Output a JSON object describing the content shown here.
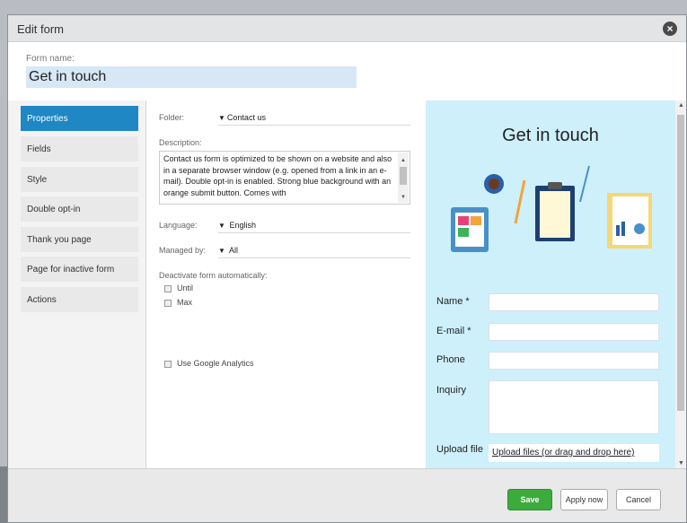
{
  "dialog": {
    "title": "Edit form",
    "close_icon": "close-icon"
  },
  "form_name": {
    "label": "Form name:",
    "value": "Get in touch"
  },
  "sidebar": {
    "items": [
      {
        "label": "Properties",
        "active": true
      },
      {
        "label": "Fields"
      },
      {
        "label": "Style"
      },
      {
        "label": "Double opt-in"
      },
      {
        "label": "Thank you page"
      },
      {
        "label": "Page for inactive form"
      },
      {
        "label": "Actions"
      }
    ]
  },
  "properties": {
    "folder_label": "Folder:",
    "folder_value": "Contact us",
    "description_label": "Description:",
    "description_value": "Contact us form is optimized to be shown on a website and also in a separate browser window (e.g. opened from a link in an e-mail). Double opt-in is enabled. Strong blue background with an orange submit button. Comes with",
    "language_label": "Language:",
    "language_value": "English",
    "managed_by_label": "Managed by:",
    "managed_by_value": "All",
    "deactivate_label": "Deactivate form automatically:",
    "until_label": "Until",
    "max_label": "Max",
    "analytics_label": "Use Google Analytics"
  },
  "preview": {
    "title": "Get in touch",
    "fields": {
      "name": "Name *",
      "email": "E-mail *",
      "phone": "Phone",
      "inquiry": "Inquiry",
      "upload": "Upload file",
      "upload_link": "Upload files (or drag and drop here)"
    }
  },
  "footer": {
    "save": "Save",
    "apply": "Apply now",
    "cancel": "Cancel"
  },
  "colors": {
    "accent": "#1e87c4",
    "save_green": "#3cab3c",
    "preview_bg": "#cdf0fa"
  }
}
